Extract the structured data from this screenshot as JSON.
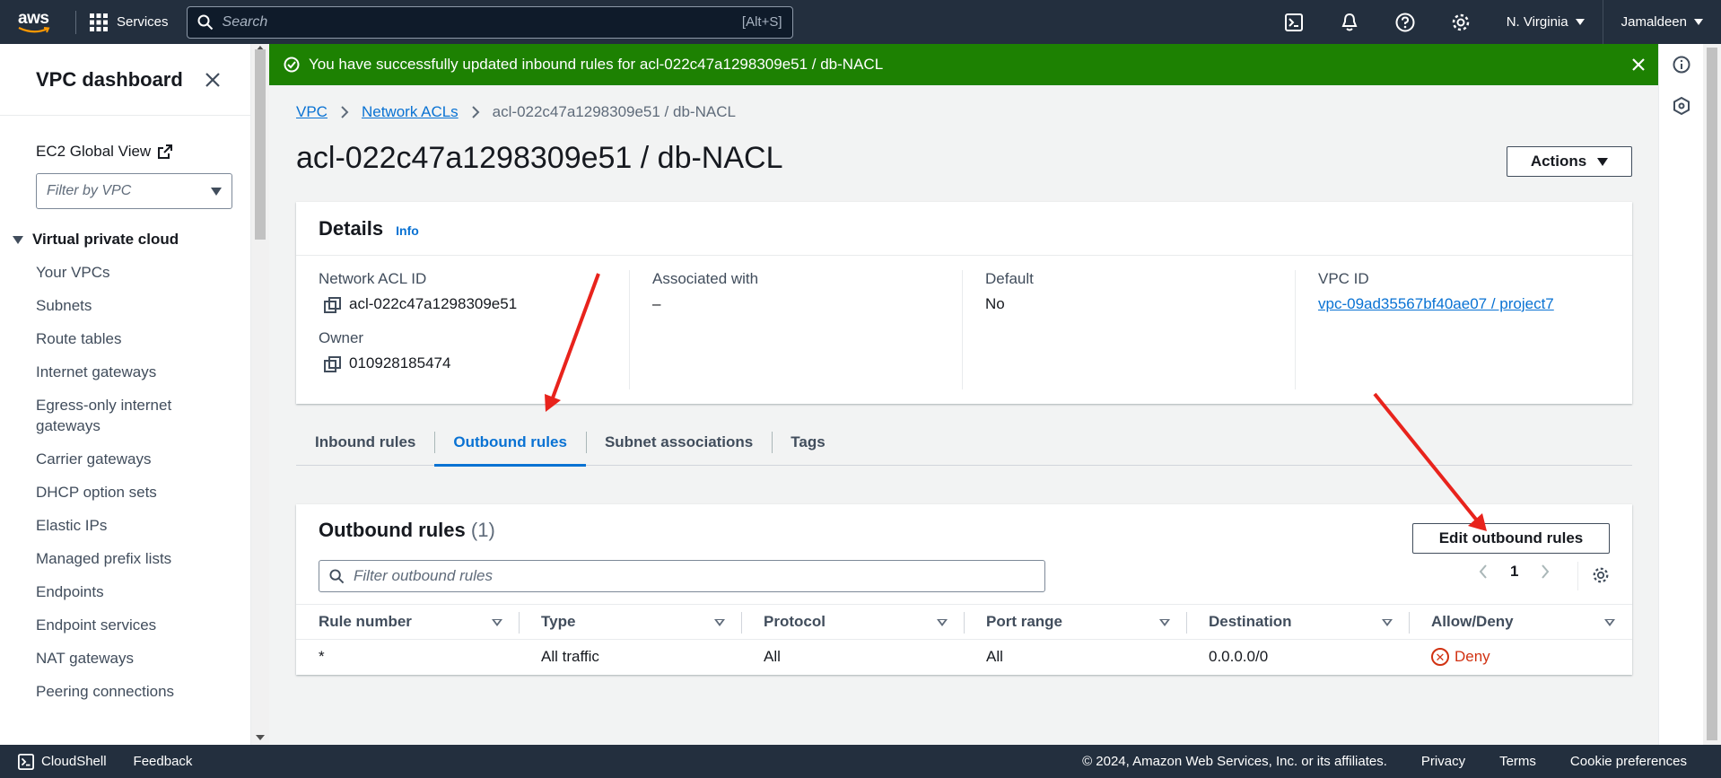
{
  "topnav": {
    "logo": "aws",
    "services_label": "Services",
    "search_placeholder": "Search",
    "search_shortcut": "[Alt+S]",
    "region": "N. Virginia",
    "user": "Jamaldeen"
  },
  "flash": {
    "message": "You have successfully updated inbound rules for acl-022c47a1298309e51 / db-NACL",
    "color": "#1d8102"
  },
  "sidebar": {
    "title": "VPC dashboard",
    "global_view": "EC2 Global View",
    "filter_placeholder": "Filter by VPC",
    "section": "Virtual private cloud",
    "items": [
      "Your VPCs",
      "Subnets",
      "Route tables",
      "Internet gateways",
      "Egress-only internet gateways",
      "Carrier gateways",
      "DHCP option sets",
      "Elastic IPs",
      "Managed prefix lists",
      "Endpoints",
      "Endpoint services",
      "NAT gateways",
      "Peering connections"
    ]
  },
  "breadcrumb": {
    "items": [
      "VPC",
      "Network ACLs"
    ],
    "current": "acl-022c47a1298309e51 / db-NACL"
  },
  "page": {
    "title": "acl-022c47a1298309e51 / db-NACL",
    "actions_label": "Actions"
  },
  "details": {
    "heading": "Details",
    "info": "Info",
    "network_acl_id_label": "Network ACL ID",
    "network_acl_id": "acl-022c47a1298309e51",
    "owner_label": "Owner",
    "owner": "010928185474",
    "associated_label": "Associated with",
    "associated": "–",
    "default_label": "Default",
    "default": "No",
    "vpc_id_label": "VPC ID",
    "vpc_id": "vpc-09ad35567bf40ae07 / project7"
  },
  "tabs": [
    "Inbound rules",
    "Outbound rules",
    "Subnet associations",
    "Tags"
  ],
  "active_tab": "Outbound rules",
  "rules": {
    "heading": "Outbound rules",
    "count": "(1)",
    "edit_label": "Edit outbound rules",
    "filter_placeholder": "Filter outbound rules",
    "page": "1",
    "columns": [
      "Rule number",
      "Type",
      "Protocol",
      "Port range",
      "Destination",
      "Allow/Deny"
    ],
    "rows": [
      {
        "rule_number": "*",
        "type": "All traffic",
        "protocol": "All",
        "port_range": "All",
        "destination": "0.0.0.0/0",
        "allow_deny": "Deny"
      }
    ]
  },
  "footer": {
    "cloudshell": "CloudShell",
    "feedback": "Feedback",
    "copyright": "© 2024, Amazon Web Services, Inc. or its affiliates.",
    "privacy": "Privacy",
    "terms": "Terms",
    "cookies": "Cookie preferences"
  }
}
